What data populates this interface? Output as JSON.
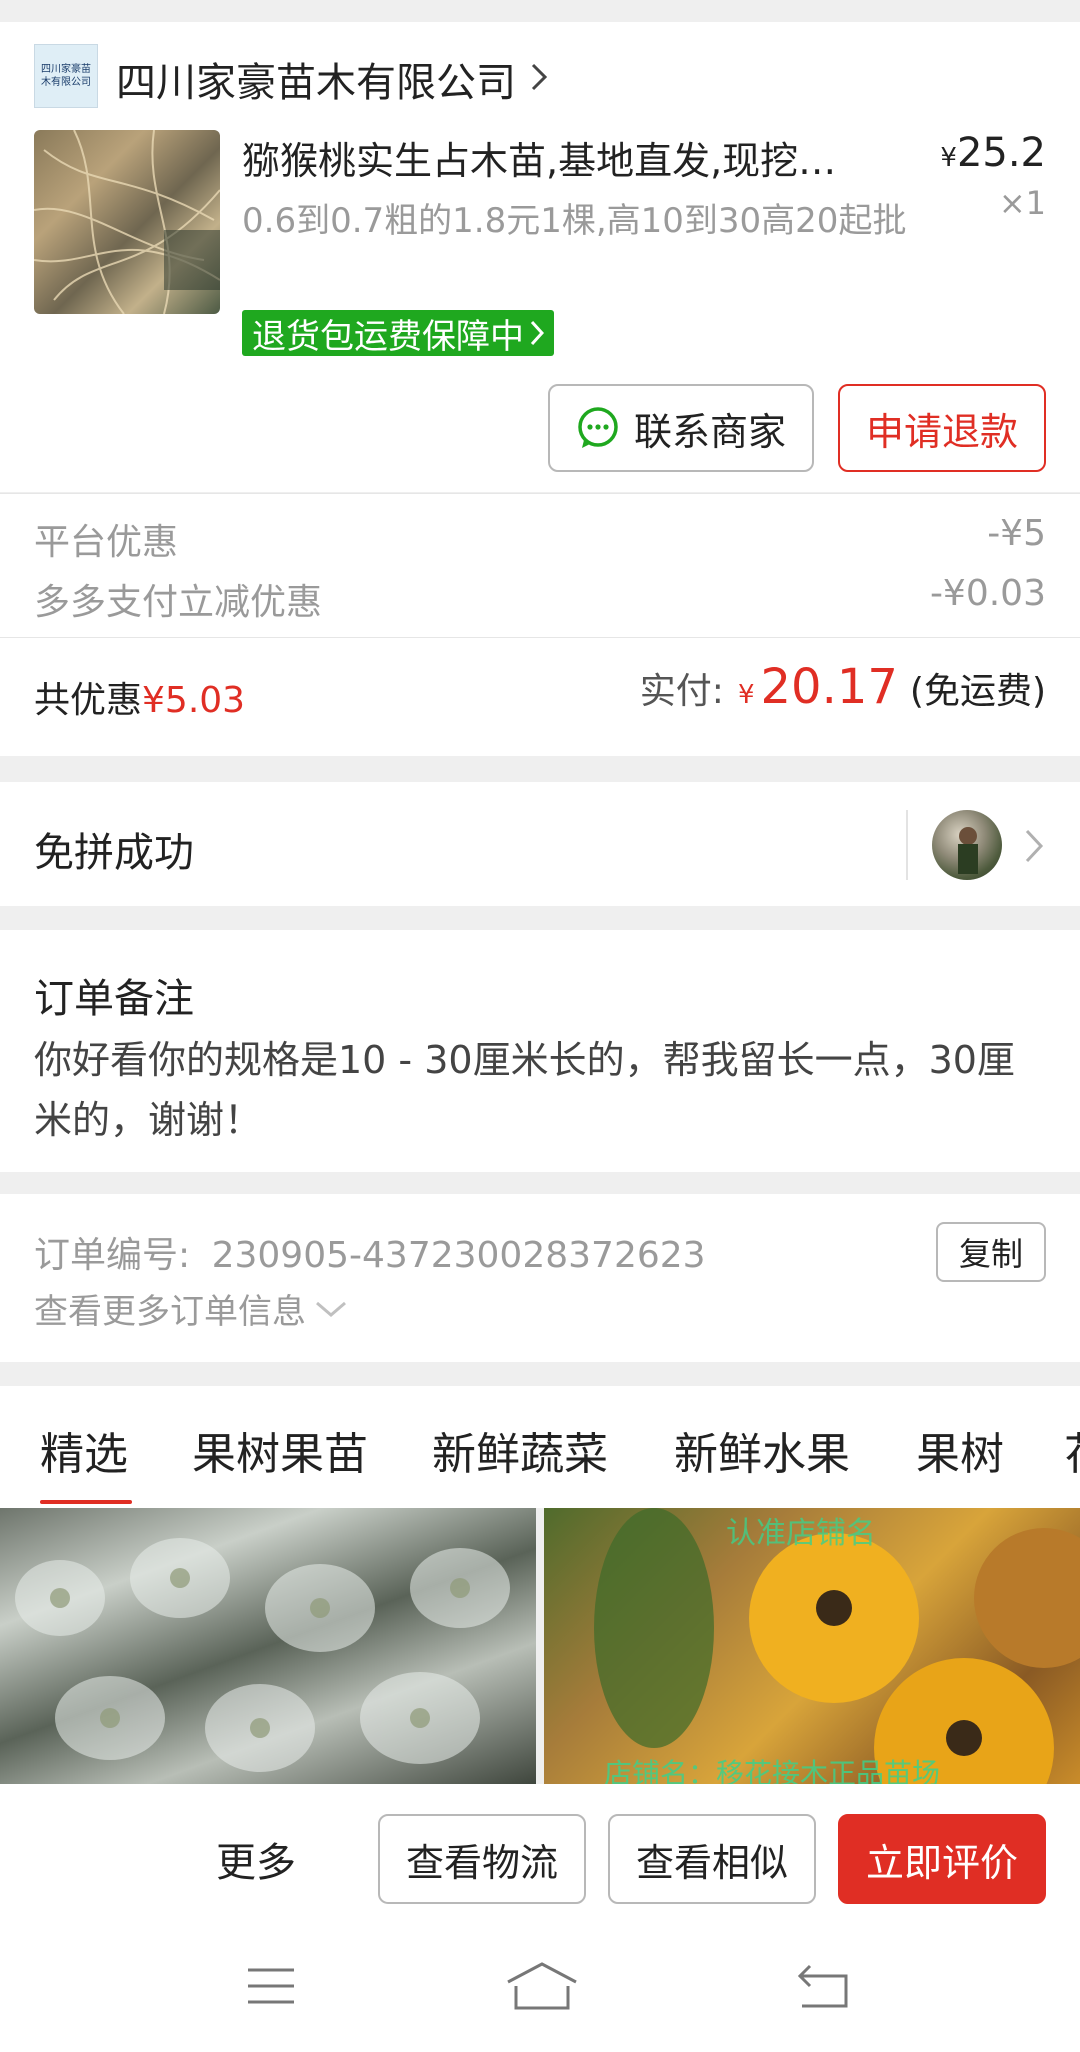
{
  "shop": {
    "name": "四川家豪苗木有限公司",
    "logo_text": "四川家豪苗木有限公司"
  },
  "product": {
    "title": "猕猴桃实生占木苗,基地直发,现挖…",
    "spec": "0.6到0.7粗的1.8元1棵,高10到30高20起批",
    "currency": "¥",
    "price": "25.2",
    "quantity": "×1",
    "guarantee": "退货包运费保障中"
  },
  "actions": {
    "contact": "联系商家",
    "refund": "申请退款"
  },
  "discounts": [
    {
      "label": "平台优惠",
      "value": "-¥5"
    },
    {
      "label": "多多支付立减优惠",
      "value": "-¥0.03"
    }
  ],
  "summary": {
    "total_discount_label": "共优惠",
    "total_discount_value": "¥5.03",
    "paid_label": "实付:",
    "paid_currency": "¥",
    "paid_value": "20.17",
    "shipping_note": "(免运费)"
  },
  "group": {
    "status": "免拼成功"
  },
  "remark": {
    "title": "订单备注",
    "text": "你好看你的规格是10 - 30厘米长的，帮我留长一点，30厘米的，谢谢！"
  },
  "order_info": {
    "number_label": "订单编号:",
    "number_value": "230905-437230028372623",
    "copy_label": "复制",
    "more_label": "查看更多订单信息"
  },
  "tabs": [
    "精选",
    "果树果苗",
    "新鲜蔬菜",
    "新鲜水果",
    "果树",
    "花"
  ],
  "recommend": {
    "right_image_text_top": "认准店铺名",
    "right_image_text_bottom": "店铺名：移花接木正品苗场"
  },
  "bottom_bar": {
    "more": "更多",
    "logistics": "查看物流",
    "similar": "查看相似",
    "review": "立即评价"
  },
  "colors": {
    "accent_red": "#e02e24",
    "guarantee_green": "#1fa81f"
  }
}
